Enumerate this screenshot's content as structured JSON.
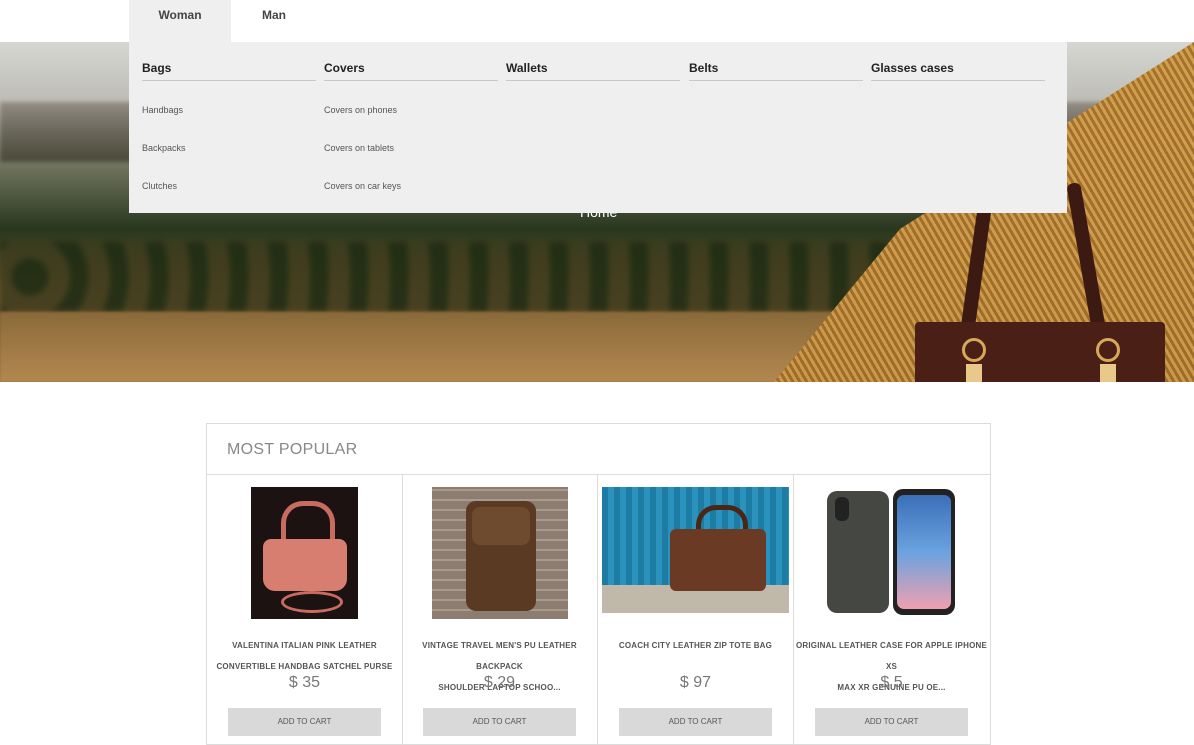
{
  "nav": {
    "tabs": [
      {
        "label": "Woman",
        "active": true
      },
      {
        "label": "Man",
        "active": false
      }
    ]
  },
  "hero": {
    "breadcrumb": "Home"
  },
  "dropdown": {
    "columns": [
      {
        "title": "Bags",
        "items": [
          "Handbags",
          "Backpacks",
          "Clutches"
        ]
      },
      {
        "title": "Covers",
        "items": [
          "Covers on phones",
          "Covers on tablets",
          "Covers on car keys"
        ]
      },
      {
        "title": "Wallets",
        "items": []
      },
      {
        "title": "Belts",
        "items": []
      },
      {
        "title": "Glasses cases",
        "items": []
      }
    ]
  },
  "popular": {
    "title": "MOST POPULAR",
    "products": [
      {
        "name_line1": "VALENTINA ITALIAN PINK LEATHER",
        "name_line2": "CONVERTIBLE HANDBAG SATCHEL PURSE",
        "price": "$ 35",
        "button": "ADD TO CART"
      },
      {
        "name_line1": "VINTAGE TRAVEL MEN'S PU LEATHER BACKPACK",
        "name_line2": "SHOULDER LAPTOP SCHOO...",
        "price": "$ 29",
        "button": "ADD TO CART"
      },
      {
        "name_line1": "COACH CITY LEATHER ZIP TOTE BAG",
        "name_line2": "",
        "price": "$ 97",
        "button": "ADD TO CART"
      },
      {
        "name_line1": "ORIGINAL LEATHER CASE FOR APPLE IPHONE XS",
        "name_line2": "MAX XR GENUINE PU OE...",
        "price": "$ 5",
        "button": "ADD TO CART"
      }
    ]
  },
  "colors": {
    "dropdown_bg": "#efefef",
    "button_bg": "#d9d9d9",
    "border": "#dcdcdc"
  }
}
